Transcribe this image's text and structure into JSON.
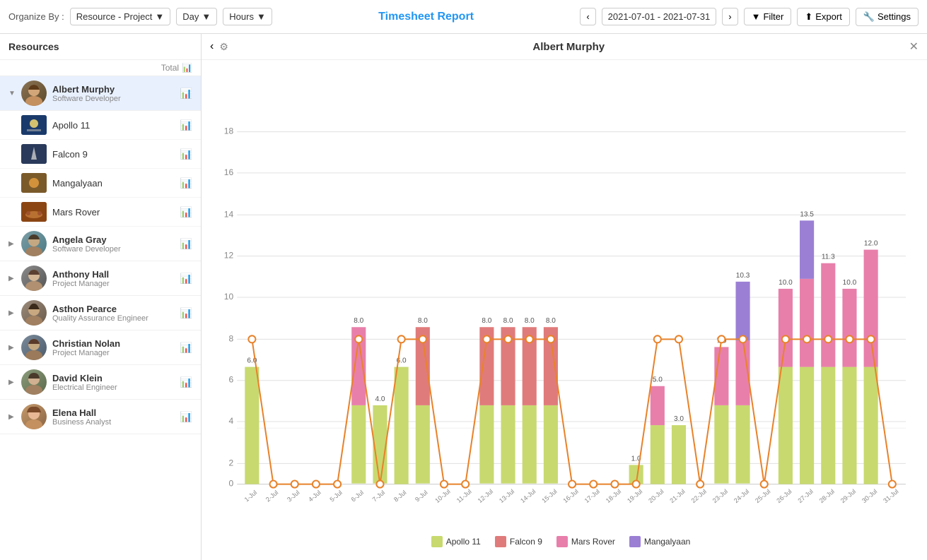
{
  "toolbar": {
    "organize_label": "Organize By :",
    "organize_value": "Resource - Project",
    "day_label": "Day",
    "hours_label": "Hours",
    "title": "Timesheet Report",
    "date_range": "2021-07-01 - 2021-07-31",
    "filter_label": "Filter",
    "export_label": "Export",
    "settings_label": "Settings"
  },
  "sidebar": {
    "title": "Resources",
    "total_label": "Total",
    "resources": [
      {
        "id": "albert",
        "name": "Albert Murphy",
        "role": "Software Developer",
        "expanded": true,
        "active": true,
        "projects": [
          {
            "id": "apollo11",
            "name": "Apollo 11"
          },
          {
            "id": "falcon9",
            "name": "Falcon 9"
          },
          {
            "id": "mangalyaan",
            "name": "Mangalyaan"
          },
          {
            "id": "marsrover",
            "name": "Mars Rover"
          }
        ]
      },
      {
        "id": "angela",
        "name": "Angela Gray",
        "role": "Software Developer",
        "expanded": false
      },
      {
        "id": "anthony",
        "name": "Anthony Hall",
        "role": "Project Manager",
        "expanded": false
      },
      {
        "id": "asthon",
        "name": "Asthon Pearce",
        "role": "Quality Assurance Engineer",
        "expanded": false
      },
      {
        "id": "christian",
        "name": "Christian Nolan",
        "role": "Project Manager",
        "expanded": false
      },
      {
        "id": "david",
        "name": "David Klein",
        "role": "Electrical Engineer",
        "expanded": false
      },
      {
        "id": "elena",
        "name": "Elena Hall",
        "role": "Business Analyst",
        "expanded": false
      }
    ]
  },
  "chart": {
    "title": "Albert Murphy",
    "y_max": 18,
    "y_labels": [
      18,
      16,
      14,
      12,
      10,
      8,
      6,
      4,
      2,
      0
    ],
    "x_labels": [
      "1-Jul",
      "2-Jul",
      "3-Jul",
      "4-Jul",
      "5-Jul",
      "6-Jul",
      "7-Jul",
      "8-Jul",
      "9-Jul",
      "10-Jul",
      "11-Jul",
      "12-Jul",
      "13-Jul",
      "14-Jul",
      "15-Jul",
      "16-Jul",
      "17-Jul",
      "18-Jul",
      "19-Jul",
      "20-Jul",
      "21-Jul",
      "22-Jul",
      "23-Jul",
      "24-Jul",
      "25-Jul",
      "26-Jul",
      "27-Jul",
      "28-Jul",
      "29-Jul",
      "30-Jul",
      "31-Jul"
    ],
    "legend": [
      {
        "id": "apollo11",
        "label": "Apollo 11",
        "color": "#C8D96F"
      },
      {
        "id": "falcon9",
        "label": "Falcon 9",
        "color": "#E07B7B"
      },
      {
        "id": "marsrover",
        "label": "Mars Rover",
        "color": "#E87FAB"
      },
      {
        "id": "mangalyaan",
        "label": "Mangalyaan",
        "color": "#9B7FD4"
      }
    ],
    "capacity_line_value": 8,
    "bars": [
      {
        "day": 1,
        "apollo11": 6.0,
        "falcon9": 0,
        "marsrover": 0,
        "mangalyaan": 0,
        "total": 6.0
      },
      {
        "day": 2,
        "apollo11": 0,
        "falcon9": 0,
        "marsrover": 0,
        "mangalyaan": 0,
        "total": 0
      },
      {
        "day": 3,
        "apollo11": 0,
        "falcon9": 0,
        "marsrover": 0,
        "mangalyaan": 0,
        "total": 0
      },
      {
        "day": 4,
        "apollo11": 0,
        "falcon9": 0,
        "marsrover": 0,
        "mangalyaan": 0,
        "total": 0
      },
      {
        "day": 5,
        "apollo11": 0,
        "falcon9": 0,
        "marsrover": 0,
        "mangalyaan": 0,
        "total": 0
      },
      {
        "day": 6,
        "apollo11": 4.0,
        "falcon9": 0,
        "marsrover": 4.0,
        "mangalyaan": 0,
        "total": 8.0
      },
      {
        "day": 7,
        "apollo11": 4.0,
        "falcon9": 0,
        "marsrover": 0,
        "mangalyaan": 0,
        "total": 4.0
      },
      {
        "day": 8,
        "apollo11": 6.0,
        "falcon9": 0,
        "marsrover": 0,
        "mangalyaan": 0,
        "total": 6.0
      },
      {
        "day": 9,
        "apollo11": 4.0,
        "falcon9": 4.0,
        "marsrover": 0,
        "mangalyaan": 0,
        "total": 8.0
      },
      {
        "day": 10,
        "apollo11": 0,
        "falcon9": 0,
        "marsrover": 0,
        "mangalyaan": 0,
        "total": 0
      },
      {
        "day": 11,
        "apollo11": 0,
        "falcon9": 0,
        "marsrover": 0,
        "mangalyaan": 0,
        "total": 0
      },
      {
        "day": 12,
        "apollo11": 4.0,
        "falcon9": 4.0,
        "marsrover": 0,
        "mangalyaan": 0,
        "total": 8.0
      },
      {
        "day": 13,
        "apollo11": 4.0,
        "falcon9": 4.0,
        "marsrover": 0,
        "mangalyaan": 0,
        "total": 8.0
      },
      {
        "day": 14,
        "apollo11": 4.0,
        "falcon9": 4.0,
        "marsrover": 0,
        "mangalyaan": 0,
        "total": 8.0
      },
      {
        "day": 15,
        "apollo11": 4.0,
        "falcon9": 4.0,
        "marsrover": 0,
        "mangalyaan": 0,
        "total": 8.0
      },
      {
        "day": 16,
        "apollo11": 0,
        "falcon9": 0,
        "marsrover": 0,
        "mangalyaan": 0,
        "total": 0
      },
      {
        "day": 17,
        "apollo11": 0,
        "falcon9": 0,
        "marsrover": 0,
        "mangalyaan": 0,
        "total": 0
      },
      {
        "day": 18,
        "apollo11": 0,
        "falcon9": 0,
        "marsrover": 0,
        "mangalyaan": 0,
        "total": 0
      },
      {
        "day": 19,
        "apollo11": 1.0,
        "falcon9": 0,
        "marsrover": 0,
        "mangalyaan": 0,
        "total": 1.0
      },
      {
        "day": 20,
        "apollo11": 3.0,
        "falcon9": 0,
        "marsrover": 2.0,
        "mangalyaan": 0,
        "total": 5.0
      },
      {
        "day": 21,
        "apollo11": 3.0,
        "falcon9": 0,
        "marsrover": 0,
        "mangalyaan": 0,
        "total": 3.0
      },
      {
        "day": 22,
        "apollo11": 0,
        "falcon9": 0,
        "marsrover": 0,
        "mangalyaan": 0,
        "total": 0
      },
      {
        "day": 23,
        "apollo11": 4.0,
        "falcon9": 0,
        "marsrover": 3.0,
        "mangalyaan": 0,
        "total": 7.0
      },
      {
        "day": 24,
        "apollo11": 4.0,
        "falcon9": 0,
        "marsrover": 3.3,
        "mangalyaan": 3.0,
        "total": 10.3
      },
      {
        "day": 25,
        "apollo11": 0,
        "falcon9": 0,
        "marsrover": 0,
        "mangalyaan": 0,
        "total": 0
      },
      {
        "day": 26,
        "apollo11": 6.0,
        "falcon9": 0,
        "marsrover": 4.0,
        "mangalyaan": 0,
        "total": 10.0
      },
      {
        "day": 27,
        "apollo11": 6.0,
        "falcon9": 0,
        "marsrover": 4.5,
        "mangalyaan": 3.0,
        "total": 13.5
      },
      {
        "day": 28,
        "apollo11": 6.0,
        "falcon9": 0,
        "marsrover": 5.3,
        "mangalyaan": 0,
        "total": 11.3
      },
      {
        "day": 29,
        "apollo11": 6.0,
        "falcon9": 0,
        "marsrover": 4.0,
        "mangalyaan": 0,
        "total": 10.0
      },
      {
        "day": 30,
        "apollo11": 6.0,
        "falcon9": 0,
        "marsrover": 6.0,
        "mangalyaan": 0,
        "total": 12.0
      },
      {
        "day": 31,
        "apollo11": 0,
        "falcon9": 0,
        "marsrover": 0,
        "mangalyaan": 0,
        "total": 0
      }
    ]
  }
}
